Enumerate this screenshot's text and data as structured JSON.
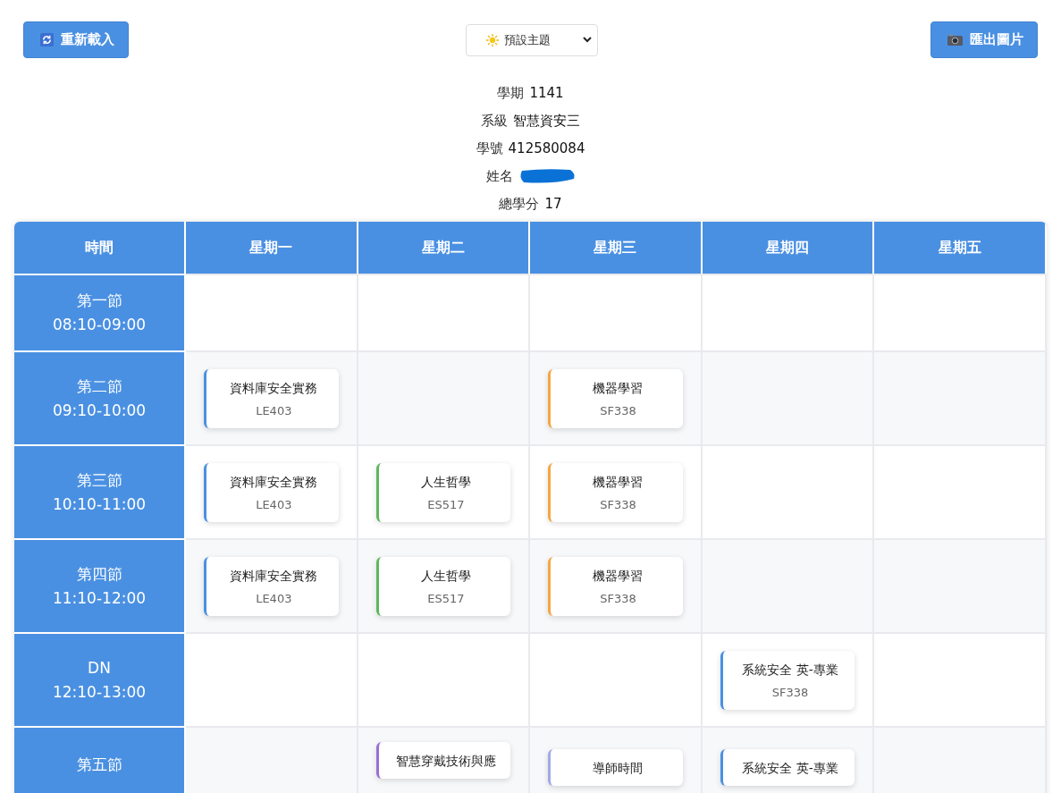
{
  "toolbar": {
    "reload_button": "重新載入",
    "theme_select": "預設主題",
    "export_button": "匯出圖片"
  },
  "info": [
    {
      "kind": "text",
      "label": "學期",
      "value": "1141"
    },
    {
      "kind": "text",
      "label": "系級",
      "value": "智慧資安三"
    },
    {
      "kind": "text",
      "label": "學號",
      "value": "412580084"
    },
    {
      "kind": "redacted",
      "label": "姓名"
    },
    {
      "kind": "text",
      "label": "總學分",
      "value": "17"
    }
  ],
  "table": {
    "columns": [
      "時間",
      "星期一",
      "星期二",
      "星期三",
      "星期四",
      "星期五"
    ],
    "rows": [
      {
        "cells": [
          {
            "kind": "period",
            "period": "第一節",
            "time": "08:10-09:00"
          },
          "",
          "",
          "",
          "",
          ""
        ]
      },
      {
        "cells": [
          {
            "kind": "period",
            "period": "第二節",
            "time": "09:10-10:00"
          },
          {
            "kind": "course",
            "title": "資料庫安全實務",
            "room": "LE403",
            "color": "#4a90e2"
          },
          "",
          {
            "kind": "course",
            "title": "機器學習",
            "room": "SF338",
            "color": "#f5a742"
          },
          "",
          ""
        ]
      },
      {
        "cells": [
          {
            "kind": "period",
            "period": "第三節",
            "time": "10:10-11:00"
          },
          {
            "kind": "course",
            "title": "資料庫安全實務",
            "room": "LE403",
            "color": "#4a90e2"
          },
          {
            "kind": "course",
            "title": "人生哲學",
            "room": "ES517",
            "color": "#5cb85c"
          },
          {
            "kind": "course",
            "title": "機器學習",
            "room": "SF338",
            "color": "#f5a742"
          },
          "",
          ""
        ]
      },
      {
        "cells": [
          {
            "kind": "period",
            "period": "第四節",
            "time": "11:10-12:00"
          },
          {
            "kind": "course",
            "title": "資料庫安全實務",
            "room": "LE403",
            "color": "#4a90e2"
          },
          {
            "kind": "course",
            "title": "人生哲學",
            "room": "ES517",
            "color": "#5cb85c"
          },
          {
            "kind": "course",
            "title": "機器學習",
            "room": "SF338",
            "color": "#f5a742"
          },
          "",
          ""
        ]
      },
      {
        "cells": [
          {
            "kind": "period",
            "period": "DN",
            "time": "12:10-13:00"
          },
          "",
          "",
          "",
          {
            "kind": "course",
            "title": "系統安全 英-專業",
            "room": "SF338",
            "color": "#4a90e2"
          },
          ""
        ]
      },
      {
        "cells": [
          {
            "kind": "period",
            "period": "第五節"
          },
          "",
          {
            "kind": "course",
            "title": "智慧穿戴技術與應",
            "color": "#9b6dd6"
          },
          {
            "kind": "course",
            "title": "導師時間",
            "color": "#a3a8e6"
          },
          {
            "kind": "course",
            "title": "系統安全 英-專業",
            "color": "#4a90e2"
          },
          ""
        ]
      }
    ]
  }
}
